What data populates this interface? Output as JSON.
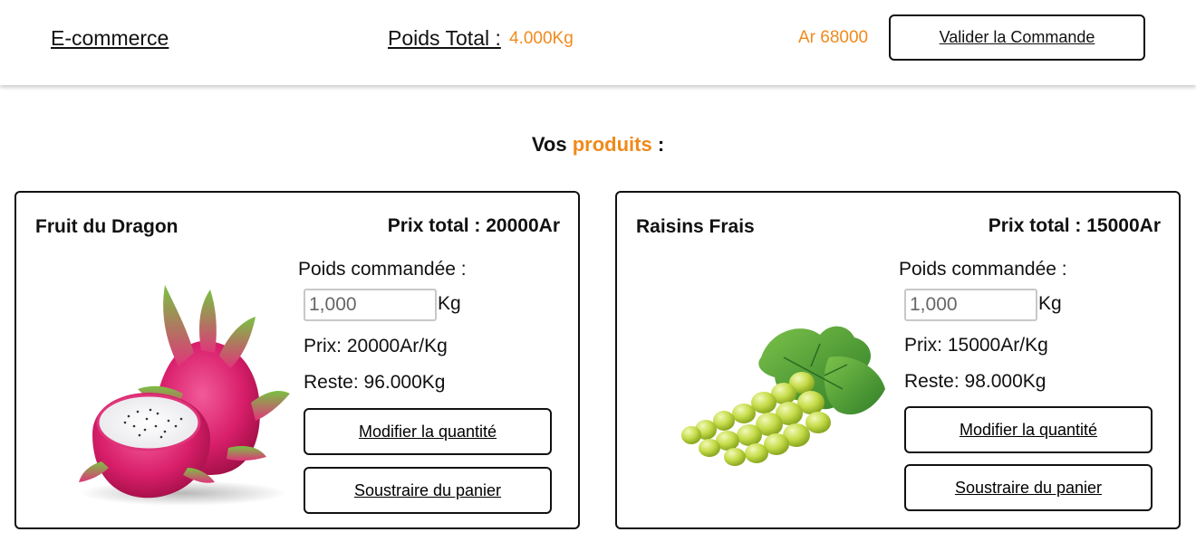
{
  "header": {
    "brand": "E-commerce",
    "total_weight_label": "Poids Total :",
    "total_weight_value": "4.000Kg",
    "total_price": "Ar 68000",
    "validate_label": "Valider la Commande"
  },
  "section": {
    "title_prefix": "Vos",
    "title_accent": "produits",
    "title_suffix": ":"
  },
  "products": [
    {
      "name": "Fruit du Dragon",
      "total": "Prix total : 20000Ar",
      "ordered_label": "Poids commandée :",
      "quantity": "1,000",
      "unit": "Kg",
      "price": "Prix: 20000Ar/Kg",
      "stock": "Reste: 96.000Kg",
      "modify_label": "Modifier la quantité",
      "remove_label": "Soustraire du panier",
      "image_icon": "dragon-fruit-image"
    },
    {
      "name": "Raisins Frais",
      "total": "Prix total : 15000Ar",
      "ordered_label": "Poids commandée :",
      "quantity": "1,000",
      "unit": "Kg",
      "price": "Prix: 15000Ar/Kg",
      "stock": "Reste: 98.000Kg",
      "modify_label": "Modifier la quantité",
      "remove_label": "Soustraire du panier",
      "image_icon": "grapes-image"
    }
  ],
  "colors": {
    "accent": "#f08a1c",
    "text": "#111111",
    "border": "#111111"
  }
}
